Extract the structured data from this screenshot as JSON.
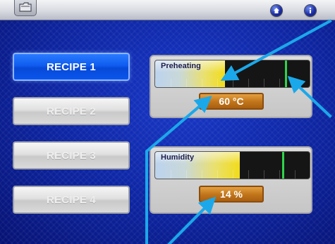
{
  "sidebar": {
    "recipes": [
      {
        "label": "RECIPE 1",
        "active": true
      },
      {
        "label": "RECIPE 2",
        "active": false
      },
      {
        "label": "RECIPE 3",
        "active": false
      },
      {
        "label": "RECIPE 4",
        "active": false
      }
    ]
  },
  "preheating": {
    "label": "Preheating",
    "value": "60 °C",
    "level": 0.45,
    "setpoint": 0.84
  },
  "humidity": {
    "label": "Humidity",
    "value": "14 %",
    "level": 0.55,
    "setpoint": 0.82
  },
  "icons": {
    "top_left": "folder-icon",
    "top_right": [
      "home-icon",
      "info-icon"
    ]
  },
  "colors": {
    "active_button": "#0f5cf0",
    "value_box": "#c0741a",
    "setpoint_marker": "#2fd34a",
    "callout_arrow": "#1ba8ea"
  }
}
